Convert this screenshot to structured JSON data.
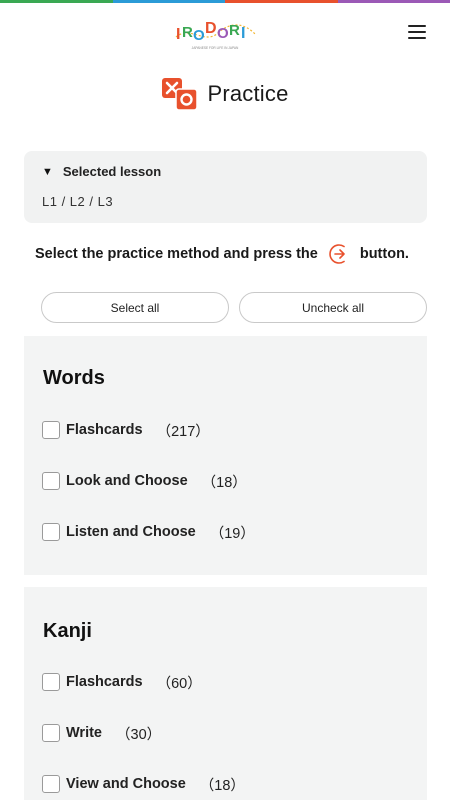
{
  "colors": {
    "top_bar": [
      "#3aa853",
      "#2b9bd7",
      "#e8512d",
      "#9b59b6"
    ],
    "accent": "#e8512d",
    "panel_bg": "#f3f4f4"
  },
  "header": {
    "logo": {
      "letters": [
        "I",
        "R",
        "O",
        "D",
        "O",
        "R",
        "I"
      ],
      "subtitle": "JAPANESE FOR LIFE IN JAPAN"
    },
    "menu_icon": "hamburger-icon"
  },
  "page": {
    "title": "Practice",
    "title_icon": "practice-icon"
  },
  "lesson": {
    "label": "Selected lesson",
    "value": "L1 / L2 / L3"
  },
  "instruction": {
    "before": "Select the practice method and press the",
    "after": "button.",
    "icon": "arrow-right-circle-icon"
  },
  "buttons": {
    "select_all": "Select all",
    "uncheck_all": "Uncheck all"
  },
  "sections": {
    "words": {
      "title": "Words",
      "options": [
        {
          "label": "Flashcards",
          "count": "（217）"
        },
        {
          "label": "Look and Choose",
          "count": "（18）"
        },
        {
          "label": "Listen and Choose",
          "count": "（19）"
        }
      ]
    },
    "kanji": {
      "title": "Kanji",
      "options": [
        {
          "label": "Flashcards",
          "count": "（60）"
        },
        {
          "label": "Write",
          "count": "（30）"
        },
        {
          "label": "View and Choose",
          "count": "（18）"
        }
      ]
    }
  }
}
